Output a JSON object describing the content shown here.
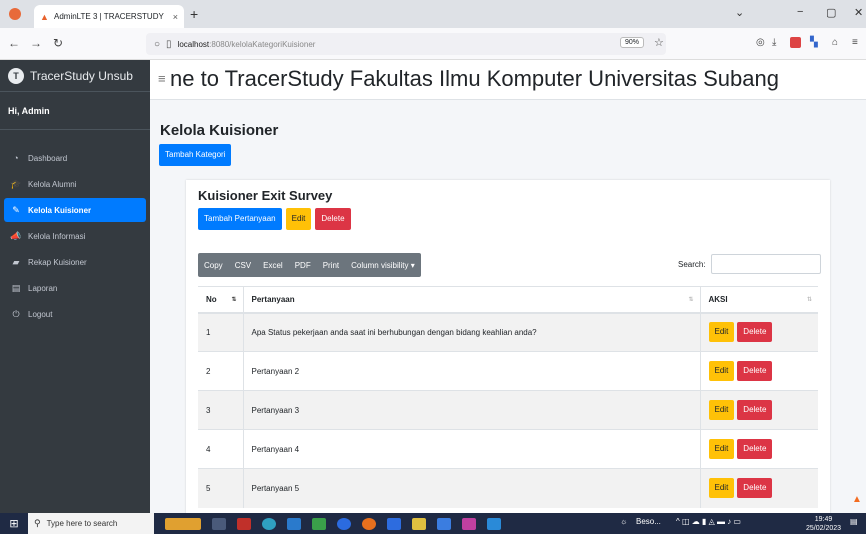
{
  "browser": {
    "tab_title": "AdminLTE 3 | TRACERSTUDY",
    "tab_close": "×",
    "new_tab": "+",
    "url_host": "localhost",
    "url_path": ":8080/kelolaKategoriKuisioner",
    "zoom": "90%",
    "window_controls": [
      "⌄",
      "−",
      "▢",
      "✕"
    ]
  },
  "sidebar": {
    "brand": "TracerStudy Unsub",
    "user": "Hi, Admin",
    "items": [
      {
        "label": "Dashboard",
        "icon": "dashboard-icon",
        "glyph": "◔"
      },
      {
        "label": "Kelola Alumni",
        "icon": "graduation-cap-icon",
        "glyph": "🎓"
      },
      {
        "label": "Kelola Kuisioner",
        "icon": "edit-icon",
        "glyph": "✎",
        "active": true
      },
      {
        "label": "Kelola Informasi",
        "icon": "bullhorn-icon",
        "glyph": "📣"
      },
      {
        "label": "Rekap Kuisioner",
        "icon": "folder-icon",
        "glyph": "▰"
      },
      {
        "label": "Laporan",
        "icon": "report-icon",
        "glyph": "▤"
      },
      {
        "label": "Logout",
        "icon": "power-icon",
        "glyph": "⏻"
      }
    ]
  },
  "header": {
    "welcome": "ne to TracerStudy Fakultas Ilmu Komputer Universitas Subang"
  },
  "page": {
    "title": "Kelola Kuisioner",
    "add_category": "Tambah Kategori"
  },
  "card": {
    "title": "Kuisioner Exit Survey",
    "add_question": "Tambah Pertanyaan",
    "edit": "Edit",
    "delete": "Delete"
  },
  "datatable": {
    "buttons": [
      "Copy",
      "CSV",
      "Excel",
      "PDF",
      "Print",
      "Column visibility ▾"
    ],
    "search_label": "Search:",
    "columns": [
      "No",
      "Pertanyaan",
      "AKSI"
    ],
    "rows": [
      {
        "no": "1",
        "question": "Apa Status pekerjaan anda saat ini berhubungan dengan bidang keahlian anda?"
      },
      {
        "no": "2",
        "question": "Pertanyaan 2"
      },
      {
        "no": "3",
        "question": "Pertanyaan 3"
      },
      {
        "no": "4",
        "question": "Pertanyaan 4"
      },
      {
        "no": "5",
        "question": "Pertanyaan 5"
      }
    ],
    "row_edit": "Edit",
    "row_delete": "Delete"
  },
  "taskbar": {
    "search_placeholder": "Type here to search",
    "weather": "Beso...",
    "time": "19:49",
    "date": "25/02/2023"
  }
}
